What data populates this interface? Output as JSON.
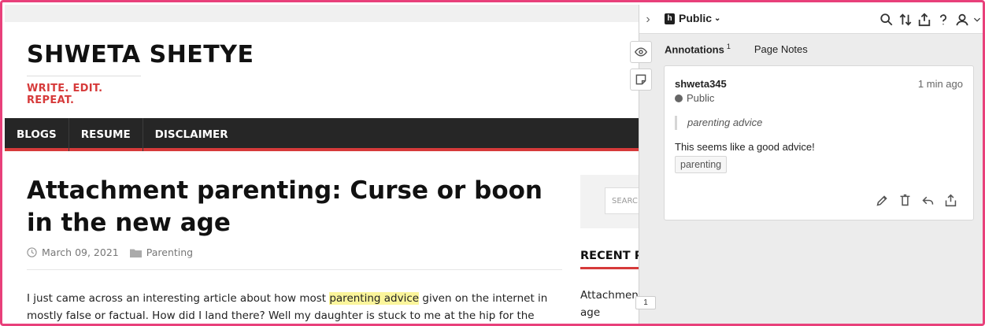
{
  "site": {
    "title": "SHWETA SHETYE",
    "tagline": "WRITE. EDIT. REPEAT.",
    "nav": [
      "BLOGS",
      "RESUME",
      "DISCLAIMER"
    ],
    "article": {
      "title": "Attachment parenting: Curse or boon in the new age",
      "date": "March 09, 2021",
      "category": "Parenting",
      "body_before": "I just came across an interesting article about how most ",
      "body_highlight": "parenting advice",
      "body_after": " given on the internet in mostly false or factual. How did I land there? Well my daughter is stuck to me at the hip for the better"
    },
    "sidebar": {
      "search_placeholder": "SEARCH",
      "recent_title": "RECENT P",
      "recent_item": "Attachment age"
    }
  },
  "hypothesis": {
    "group": "Public",
    "tabs": {
      "annotations": "Annotations",
      "annotations_count": "1",
      "page_notes": "Page Notes"
    },
    "annotation": {
      "user": "shweta345",
      "time": "1 min ago",
      "visibility": "Public",
      "quote": "parenting advice",
      "text": "This seems like a good advice!",
      "tag": "parenting"
    },
    "bucket_count": "1"
  },
  "colors": {
    "accent": "#d63a3a",
    "frame": "#e8407a",
    "highlight": "#fbf59b",
    "nav_bg": "#262626"
  }
}
